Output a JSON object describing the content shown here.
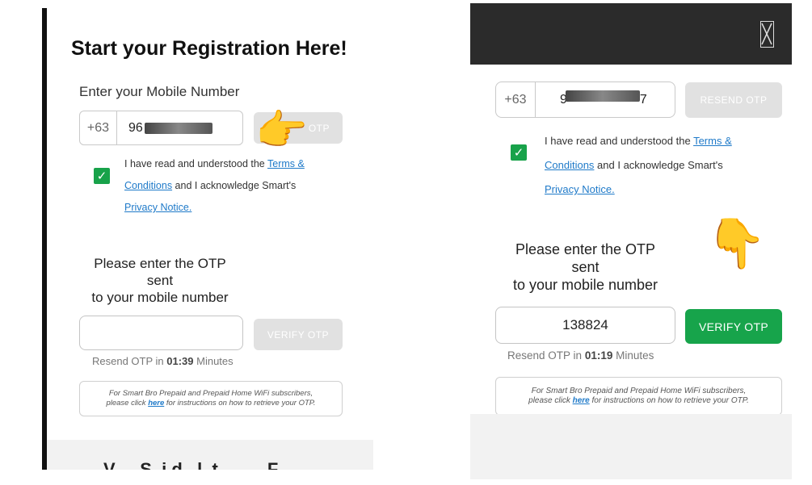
{
  "left": {
    "title": "Start your Registration Here!",
    "mobile_label": "Enter your Mobile Number",
    "country_code": "+63",
    "mobile_prefix": "96",
    "send_otp_label": "OTP",
    "terms": {
      "text1": "I have read and understood the ",
      "link1": "Terms &",
      "link1b": "Conditions",
      "text2": " and I acknowledge Smart's",
      "link2": "Privacy Notice."
    },
    "otp_msg_line1": "Please enter the OTP",
    "otp_msg_line2": "sent",
    "otp_msg_line3": "to your mobile number",
    "otp_value": "",
    "verify_label": "VERIFY OTP",
    "resend_prefix": "Resend OTP in ",
    "resend_time": "01:39",
    "resend_suffix": " Minutes",
    "note_line1": "For Smart Bro Prepaid and Prepaid Home WiFi subscribers,",
    "note_pre": "please click ",
    "note_link": "here",
    "note_post": " for instructions on how to retrieve your OTP.",
    "footer_text": "V     S  i d   l  t          F"
  },
  "right": {
    "country_code": "+63",
    "mobile_prefix": "9",
    "mobile_suffix": "7",
    "resend_otp_label": "RESEND OTP",
    "terms": {
      "text1": "I have read and understood the ",
      "link1": "Terms &",
      "link1b": "Conditions",
      "text2": " and I acknowledge Smart's",
      "link2": "Privacy Notice."
    },
    "otp_msg_line1": "Please enter the OTP",
    "otp_msg_line2": "sent",
    "otp_msg_line3": "to your mobile number",
    "otp_value": "138824",
    "verify_label": "VERIFY OTP",
    "resend_prefix": "Resend OTP in ",
    "resend_time": "01:19",
    "resend_suffix": " Minutes",
    "note_line1": "For Smart Bro Prepaid and Prepaid Home WiFi subscribers,",
    "note_pre": "please click ",
    "note_link": "here",
    "note_post": " for instructions on how to retrieve your OTP."
  },
  "icons": {
    "pointing_right": "👉",
    "pointing_down": "👇",
    "check": "✓"
  },
  "colors": {
    "accent_green": "#17a44b",
    "link_blue": "#1f7ac9",
    "disabled_button": "#e1e1e1",
    "topbar": "#2b2b2b"
  }
}
